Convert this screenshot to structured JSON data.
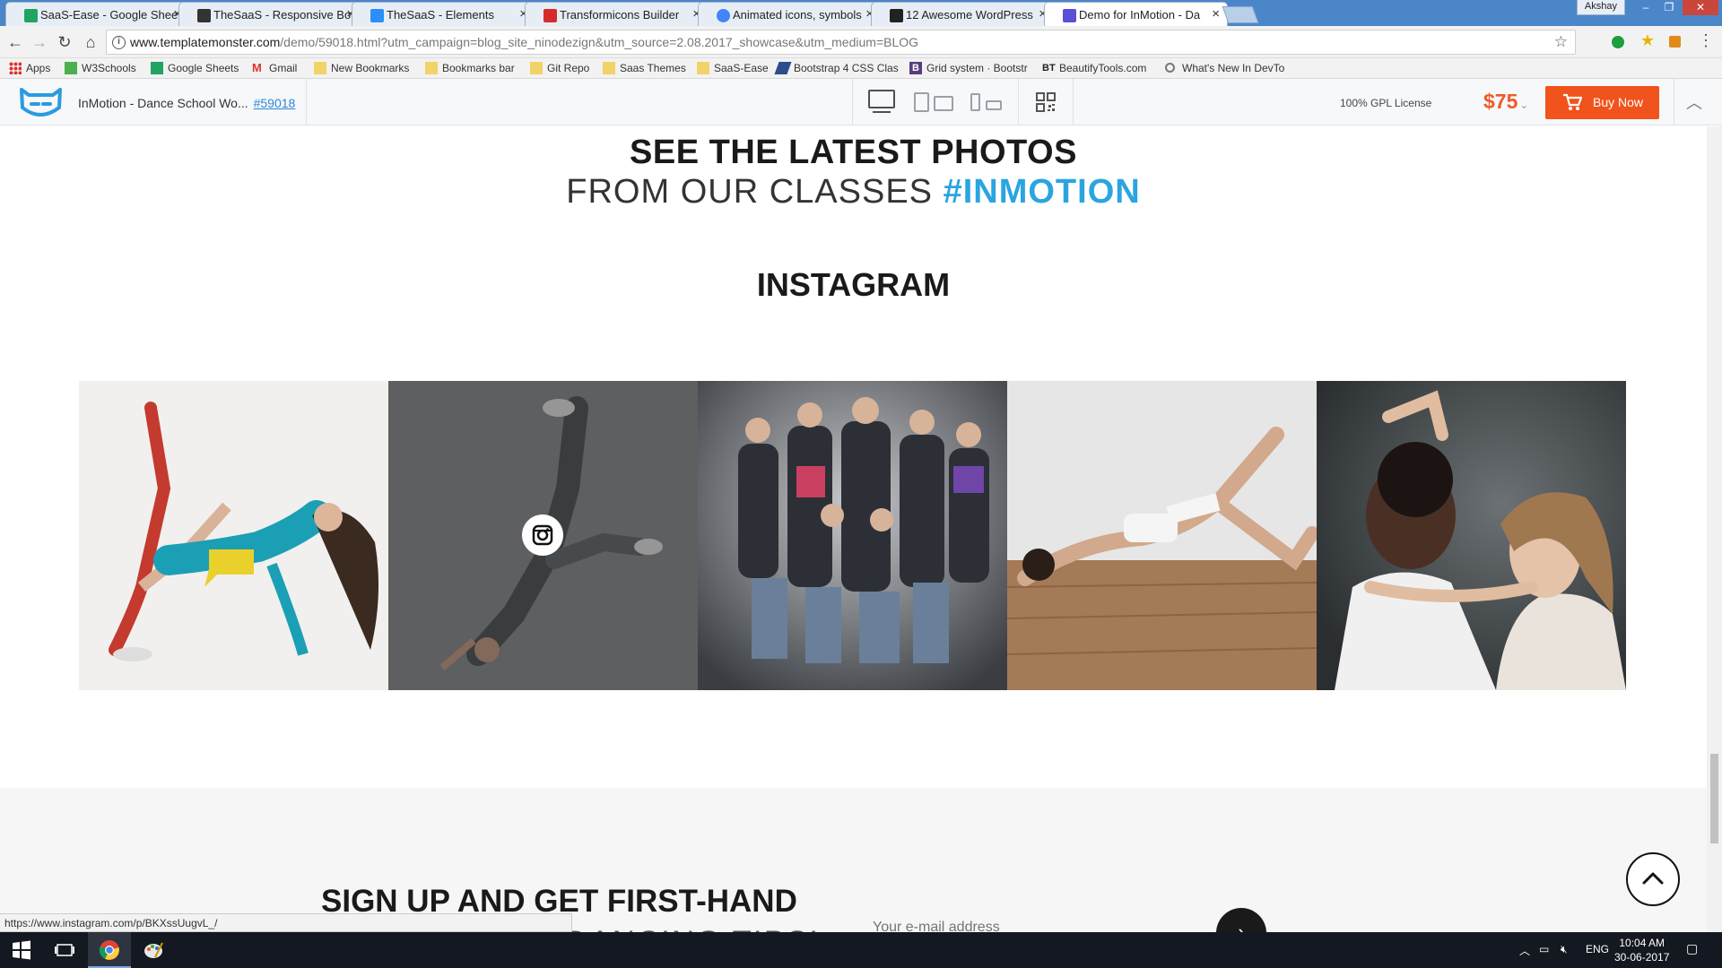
{
  "browser": {
    "tabs": [
      {
        "title": "SaaS-Ease - Google Shee",
        "favicon_color": "#1fa463"
      },
      {
        "title": "TheSaaS - Responsive Bo",
        "favicon_color": "#333333"
      },
      {
        "title": "TheSaaS - Elements",
        "favicon_color": "#2c8ef8"
      },
      {
        "title": "Transformicons Builder",
        "favicon_color": "#d62b2b"
      },
      {
        "title": "Animated icons, symbols",
        "favicon_color": "#4285f4"
      },
      {
        "title": "12 Awesome WordPress",
        "favicon_color": "#222222"
      },
      {
        "title": "Demo for InMotion - Da",
        "favicon_color": "#5b4fd6"
      }
    ],
    "user": "Akshay",
    "url_host": "www.templatemonster.com",
    "url_path": "/demo/59018.html?utm_campaign=blog_site_ninodezign&utm_source=2.08.2017_showcase&utm_medium=BLOG",
    "bookmarks": [
      {
        "label": "Apps",
        "icon": "apps-grid-icon"
      },
      {
        "label": "W3Schools",
        "icon": "w3schools-icon"
      },
      {
        "label": "Google Sheets",
        "icon": "sheets-icon"
      },
      {
        "label": "Gmail",
        "icon": "gmail-icon"
      },
      {
        "label": "New Bookmarks",
        "icon": "folder-icon"
      },
      {
        "label": "Bookmarks bar",
        "icon": "folder-icon"
      },
      {
        "label": "Git Repo",
        "icon": "folder-icon"
      },
      {
        "label": "Saas Themes",
        "icon": "folder-icon"
      },
      {
        "label": "SaaS-Ease",
        "icon": "folder-icon"
      },
      {
        "label": "Bootstrap 4 CSS Clas",
        "icon": "bootstrap-icon"
      },
      {
        "label": "Grid system · Bootstr",
        "icon": "bootstrap-b-icon"
      },
      {
        "label": "BeautifyTools.com",
        "icon": "bt-icon"
      },
      {
        "label": "What's New In DevTo",
        "icon": "devtools-icon"
      }
    ],
    "status_url": "https://www.instagram.com/p/BKXssUugvL_/"
  },
  "demo_bar": {
    "title": "InMotion - Dance School Wo...",
    "template_id": "#59018",
    "license": "100% GPL License",
    "price": "$75",
    "buy_label": "Buy Now",
    "colors": {
      "accent": "#f0531c"
    }
  },
  "page": {
    "heading_line1": "SEE THE LATEST PHOTOS",
    "heading_line2_prefix": "FROM OUR CLASSES",
    "heading_line2_tag": "#INMOTION",
    "instagram_heading": "INSTAGRAM",
    "signup_title_line1": "SIGN UP AND GET FIRST-HAND",
    "signup_title_line2": "DANCING TIPS!",
    "email_placeholder": "Your e-mail address",
    "colors": {
      "tag": "#2aa5e0"
    }
  },
  "taskbar": {
    "language": "ENG",
    "time": "10:04 AM",
    "date": "30-06-2017"
  }
}
